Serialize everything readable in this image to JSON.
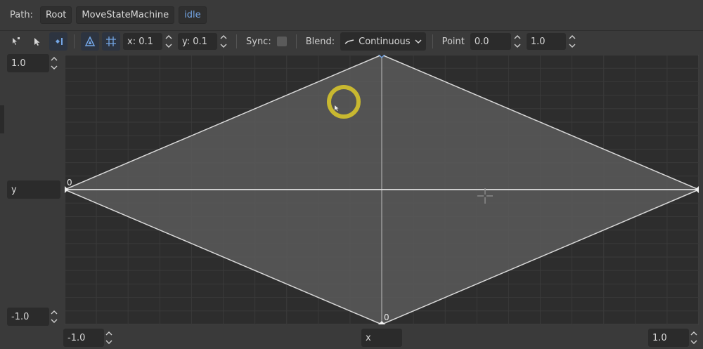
{
  "path": {
    "label": "Path:",
    "crumbs": [
      "Root",
      "MoveStateMachine",
      "idle"
    ]
  },
  "toolbar": {
    "snap_x": "x: 0.1",
    "snap_y": "y: 0.1",
    "sync_label": "Sync:",
    "blend_label": "Blend:",
    "blend_value": "Continuous",
    "point_label": "Point",
    "point_x": "0.0",
    "point_y": "1.0"
  },
  "axes": {
    "y_max": "1.0",
    "y_label": "y",
    "y_min": "-1.0",
    "x_min": "-1.0",
    "x_label": "x",
    "x_max": "1.0"
  },
  "points": [
    {
      "x": -1.0,
      "y": 0.0,
      "label": "0"
    },
    {
      "x": 0.0,
      "y": -1.0,
      "label": "0"
    },
    {
      "x": 1.0,
      "y": 0.0,
      "label": ""
    },
    {
      "x": 0.0,
      "y": 1.0,
      "label": ""
    }
  ],
  "selected_point": {
    "x": 0.0,
    "y": 1.0
  },
  "colors": {
    "accent": "#74a6e6",
    "canvas_bg": "#2d2d2d",
    "fill": "#5a5a5a",
    "cursor_ring": "#c8b830"
  }
}
